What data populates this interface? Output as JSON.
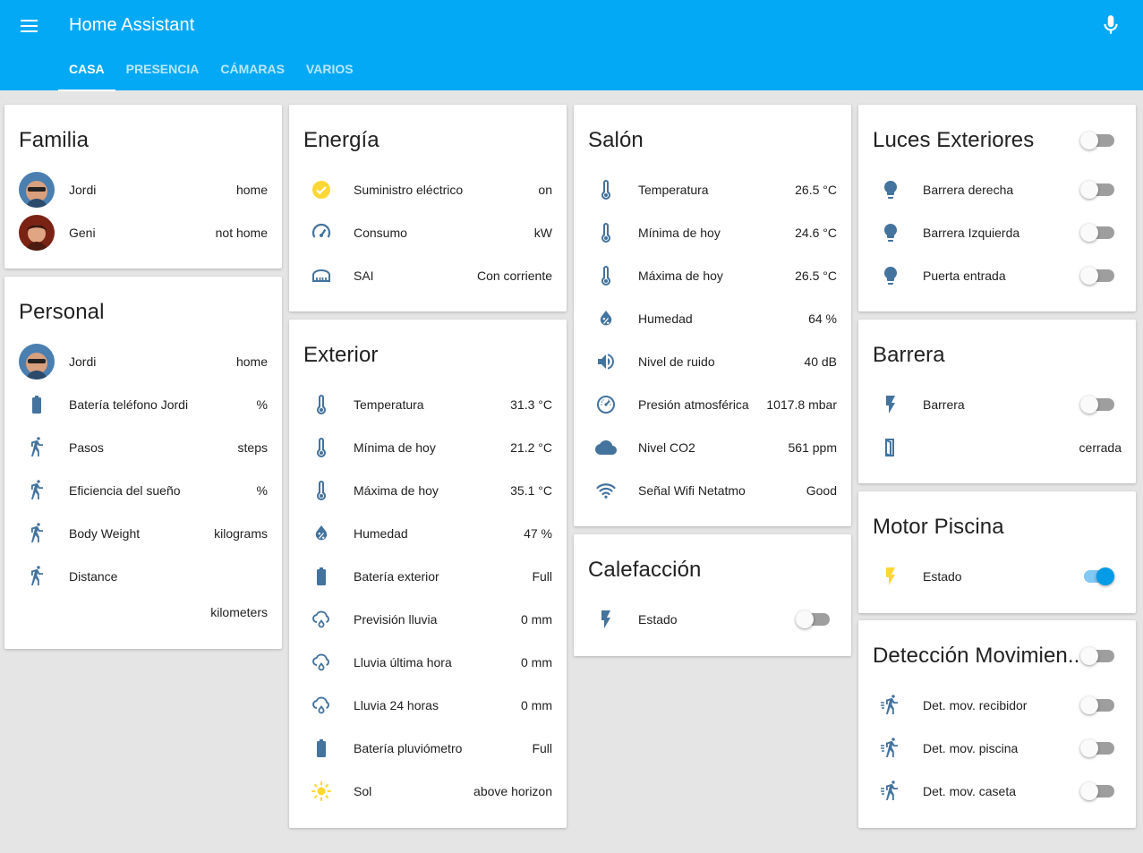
{
  "app": {
    "title": "Home Assistant"
  },
  "tabs": [
    "CASA",
    "PRESENCIA",
    "CÁMARAS",
    "VARIOS"
  ],
  "colors": {
    "header": "#03a9f4",
    "icon": "#44739e",
    "icon_active": "#fdd835",
    "toggle_on": "#039be5"
  },
  "familia": {
    "title": "Familia",
    "rows": [
      {
        "label": "Jordi",
        "value": "home",
        "icon": "avatar-jordi"
      },
      {
        "label": "Geni",
        "value": "not home",
        "icon": "avatar-geni"
      }
    ]
  },
  "personal": {
    "title": "Personal",
    "rows": [
      {
        "label": "Jordi",
        "value": "home",
        "icon": "avatar-jordi"
      },
      {
        "label": "Batería teléfono Jordi",
        "value": "%",
        "icon": "battery-icon"
      },
      {
        "label": "Pasos",
        "value": "steps",
        "icon": "walk-icon"
      },
      {
        "label": "Eficiencia del sueño",
        "value": "%",
        "icon": "walk-icon"
      },
      {
        "label": "Body Weight",
        "value": "kilograms",
        "icon": "walk-icon"
      },
      {
        "label": "Distance",
        "value": "",
        "icon": "walk-icon"
      }
    ],
    "extra_value": "kilometers"
  },
  "energia": {
    "title": "Energía",
    "rows": [
      {
        "label": "Suministro eléctrico",
        "value": "on",
        "icon": "check-circle-icon"
      },
      {
        "label": "Consumo",
        "value": "kW",
        "icon": "gauge-icon"
      },
      {
        "label": "SAI",
        "value": "Con corriente",
        "icon": "ups-icon"
      }
    ]
  },
  "exterior": {
    "title": "Exterior",
    "rows": [
      {
        "label": "Temperatura",
        "value": "31.3 °C",
        "icon": "thermometer-icon"
      },
      {
        "label": "Mínima de hoy",
        "value": "21.2 °C",
        "icon": "thermometer-icon"
      },
      {
        "label": "Máxima de hoy",
        "value": "35.1 °C",
        "icon": "thermometer-icon"
      },
      {
        "label": "Humedad",
        "value": "47 %",
        "icon": "water-percent-icon"
      },
      {
        "label": "Batería exterior",
        "value": "Full",
        "icon": "battery-icon"
      },
      {
        "label": "Previsión lluvia",
        "value": "0 mm",
        "icon": "rain-icon"
      },
      {
        "label": "Lluvia última hora",
        "value": "0 mm",
        "icon": "rain-icon"
      },
      {
        "label": "Lluvia 24 horas",
        "value": "0 mm",
        "icon": "rain-icon"
      },
      {
        "label": "Batería pluviómetro",
        "value": "Full",
        "icon": "battery-icon"
      },
      {
        "label": "Sol",
        "value": "above horizon",
        "icon": "sun-icon"
      }
    ]
  },
  "salon": {
    "title": "Salón",
    "rows": [
      {
        "label": "Temperatura",
        "value": "26.5 °C",
        "icon": "thermometer-icon"
      },
      {
        "label": "Mínima de hoy",
        "value": "24.6 °C",
        "icon": "thermometer-icon"
      },
      {
        "label": "Máxima de hoy",
        "value": "26.5 °C",
        "icon": "thermometer-icon"
      },
      {
        "label": "Humedad",
        "value": "64 %",
        "icon": "water-percent-icon"
      },
      {
        "label": "Nivel de ruido",
        "value": "40 dB",
        "icon": "volume-icon"
      },
      {
        "label": "Presión atmosférica",
        "value": "1017.8 mbar",
        "icon": "barometer-icon"
      },
      {
        "label": "Nivel CO2",
        "value": "561 ppm",
        "icon": "cloud-icon"
      },
      {
        "label": "Señal Wifi Netatmo",
        "value": "Good",
        "icon": "wifi-icon"
      }
    ]
  },
  "calefaccion": {
    "title": "Calefacción",
    "rows": [
      {
        "label": "Estado",
        "on": false,
        "icon": "flash-icon"
      }
    ]
  },
  "luces": {
    "title": "Luces Exteriores",
    "header_on": false,
    "rows": [
      {
        "label": "Barrera derecha",
        "on": false,
        "icon": "lightbulb-icon"
      },
      {
        "label": "Barrera Izquierda",
        "on": false,
        "icon": "lightbulb-icon"
      },
      {
        "label": "Puerta entrada",
        "on": false,
        "icon": "lightbulb-icon"
      }
    ]
  },
  "barrera": {
    "title": "Barrera",
    "rows": [
      {
        "label": "Barrera",
        "on": false,
        "icon": "flash-icon"
      },
      {
        "label": "",
        "value": "cerrada",
        "icon": "door-icon"
      }
    ]
  },
  "motor": {
    "title": "Motor Piscina",
    "rows": [
      {
        "label": "Estado",
        "on": true,
        "icon": "flash-yellow-icon"
      }
    ]
  },
  "deteccion": {
    "title": "Detección Movimien..",
    "header_on": false,
    "rows": [
      {
        "label": "Det. mov. recibidor",
        "on": false,
        "icon": "motion-icon"
      },
      {
        "label": "Det. mov. piscina",
        "on": false,
        "icon": "motion-icon"
      },
      {
        "label": "Det. mov. caseta",
        "on": false,
        "icon": "motion-icon"
      }
    ]
  }
}
